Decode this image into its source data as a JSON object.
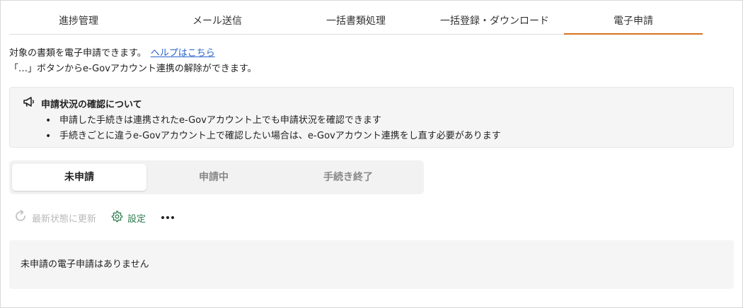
{
  "tabs": [
    {
      "label": "進捗管理"
    },
    {
      "label": "メール送信"
    },
    {
      "label": "一括書類処理"
    },
    {
      "label": "一括登録・ダウンロード"
    },
    {
      "label": "電子申請"
    }
  ],
  "active_tab_index": 4,
  "accent_color": "#d6731f",
  "description": {
    "line1": "対象の書類を電子申請できます。",
    "help_link": "ヘルプはこちら",
    "line2": "「…」ボタンからe-Govアカウント連携の解除ができます。"
  },
  "notice": {
    "icon": "megaphone-icon",
    "title": "申請状況の確認について",
    "items": [
      "申請した手続きは連携されたe-Govアカウント上でも申請状況を確認できます",
      "手続きごとに違うe-Govアカウント上で確認したい場合は、e-Govアカウント連携をし直す必要があります"
    ]
  },
  "segments": [
    {
      "label": "未申請"
    },
    {
      "label": "申請中"
    },
    {
      "label": "手続き終了"
    }
  ],
  "active_segment_index": 0,
  "toolbar": {
    "refresh_label": "最新状態に更新",
    "settings_label": "設定",
    "settings_color": "#2e7d4f"
  },
  "empty_message": "未申請の電子申請はありません"
}
